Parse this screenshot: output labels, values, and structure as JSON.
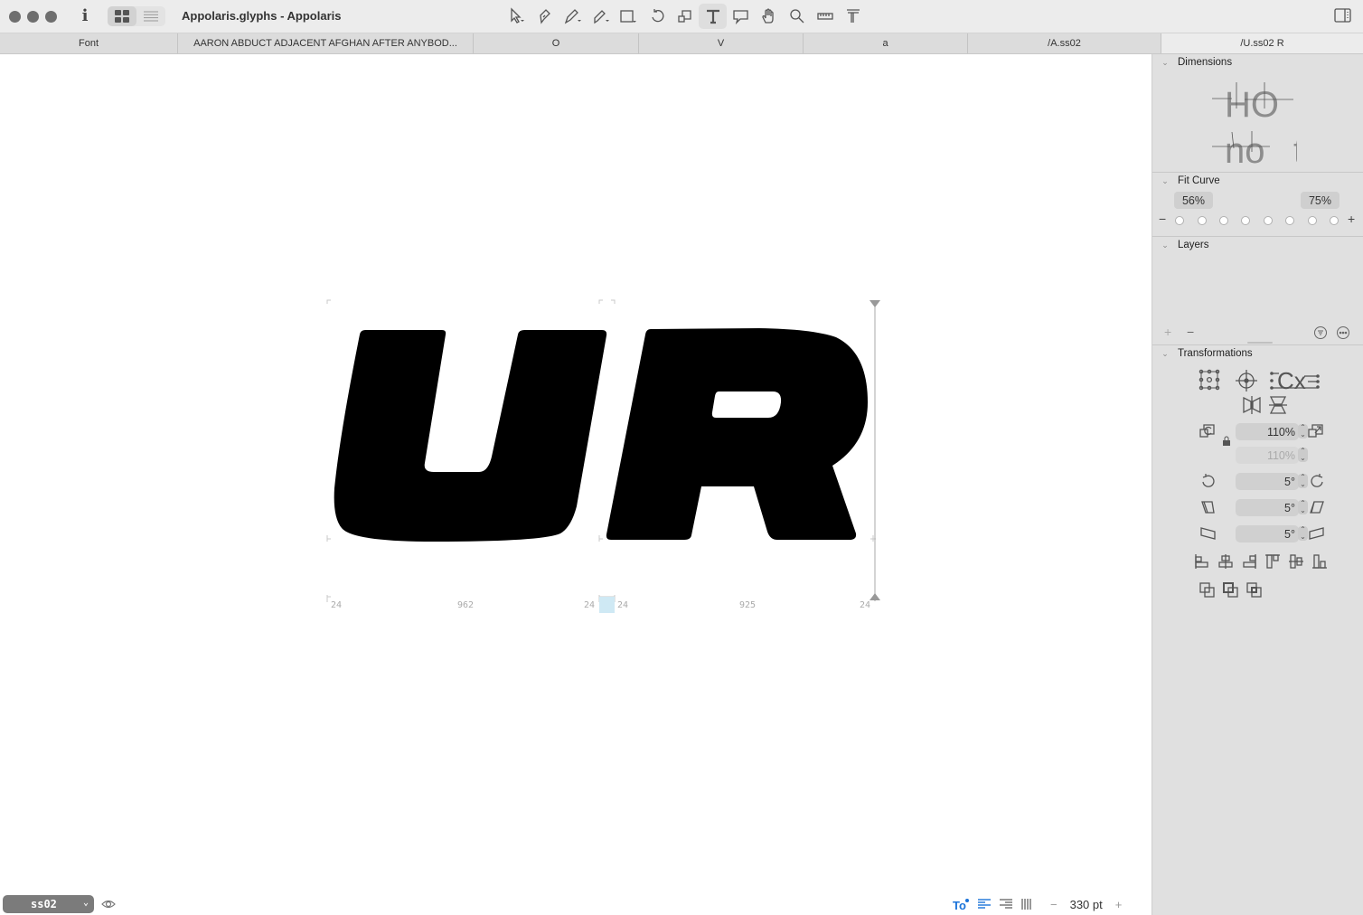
{
  "window": {
    "title": "Appolaris.glyphs - Appolaris",
    "traffic_lights": [
      "close",
      "minimize",
      "zoom"
    ]
  },
  "toolbar": {
    "view_modes": [
      {
        "name": "grid-view-icon",
        "active": true
      },
      {
        "name": "list-view-icon",
        "active": false
      }
    ],
    "tools": [
      {
        "name": "select-tool",
        "active": false
      },
      {
        "name": "pen-nib-tool",
        "active": false
      },
      {
        "name": "pen-tool",
        "active": false
      },
      {
        "name": "pencil-tool",
        "active": false
      },
      {
        "name": "rectangle-tool",
        "active": false
      },
      {
        "name": "rotate-tool",
        "active": false
      },
      {
        "name": "scale-tool",
        "active": false
      },
      {
        "name": "text-tool",
        "active": true
      },
      {
        "name": "annotation-tool",
        "active": false
      },
      {
        "name": "hand-tool",
        "active": false
      },
      {
        "name": "zoom-tool",
        "active": false
      },
      {
        "name": "measure-tool",
        "active": false
      },
      {
        "name": "metrics-tool",
        "active": false
      }
    ]
  },
  "tabs": [
    {
      "label": "Font",
      "active": false
    },
    {
      "label": "AARON ABDUCT ADJACENT AFGHAN AFTER ANYBOD...",
      "active": false
    },
    {
      "label": "O",
      "active": false
    },
    {
      "label": "V",
      "active": false
    },
    {
      "label": "a",
      "active": false
    },
    {
      "label": "/A.ss02",
      "active": false
    },
    {
      "label": "/U.ss02 R",
      "active": true
    }
  ],
  "canvas": {
    "text": "UR",
    "glyphs": [
      {
        "name": "U.ss02",
        "lsb": "24",
        "width": "962",
        "rsb": "24"
      },
      {
        "name": "R",
        "lsb": "24",
        "width": "925",
        "rsb": "24"
      }
    ]
  },
  "bottom_bar": {
    "feature_select": "ss02",
    "font_size": "330 pt",
    "minus": "−",
    "plus": "+"
  },
  "inspector": {
    "dimensions": {
      "title": "Dimensions",
      "preview_line1": "HO",
      "preview_line2a": "no",
      "preview_line2b": "t"
    },
    "fit_curve": {
      "title": "Fit Curve",
      "left_value": "56%",
      "right_value": "75%",
      "minus": "−",
      "plus": "+",
      "dot_count": 8
    },
    "layers": {
      "title": "Layers",
      "add": "+",
      "remove": "−"
    },
    "transformations": {
      "title": "Transformations",
      "scale_x": "110%",
      "scale_y": "110%",
      "rotate": "5°",
      "skew_x": "5°",
      "skew_y": "5°"
    }
  }
}
